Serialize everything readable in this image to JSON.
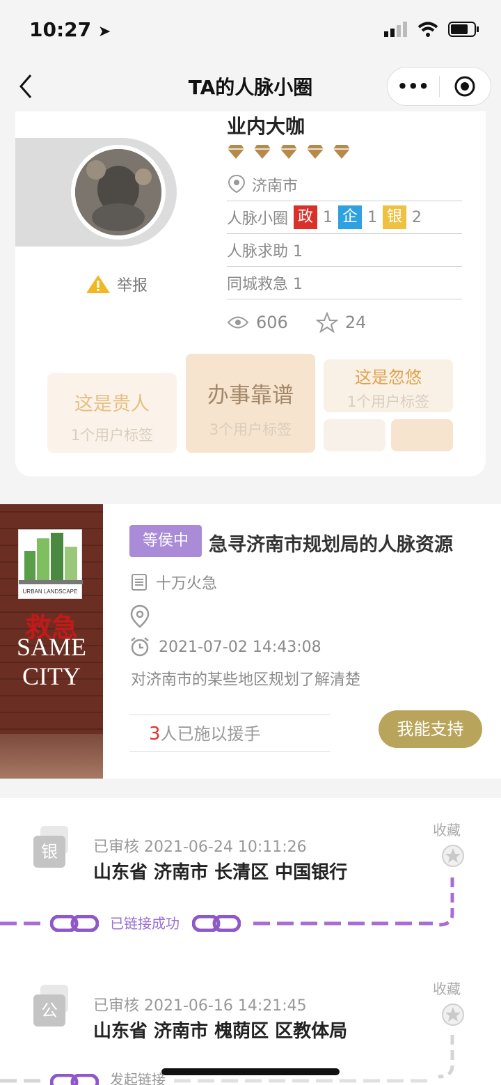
{
  "status_bar": {
    "time": "10:27"
  },
  "nav": {
    "title": "TA的人脉小圈",
    "more": "•••"
  },
  "profile": {
    "level_title": "业内大咖",
    "location": "济南市",
    "report_label": "举报",
    "circle_label": "人脉小圈",
    "circle_tags": [
      {
        "label": "政",
        "count": "1",
        "color": "#d9302a"
      },
      {
        "label": "企",
        "count": "1",
        "color": "#2fa0e0"
      },
      {
        "label": "银",
        "count": "2",
        "color": "#f0c040"
      }
    ],
    "help_row": "人脉求助 1",
    "emergency_row": "同城救急 1",
    "views": "606",
    "stars": "24",
    "tags": [
      {
        "title": "这是贵人",
        "sub": "1个用户标签"
      },
      {
        "title": "办事靠谱",
        "sub": "3个用户标签"
      },
      {
        "title": "这是忽悠",
        "sub": "1个用户标签"
      }
    ]
  },
  "help": {
    "poster_cn": "救急",
    "poster_en_1": "SAME",
    "poster_en_2": "CITY",
    "poster_logo": "URBAN LANDSCAPE",
    "status": "等侯中",
    "title": "急寻济南市规划局的人脉资源",
    "urgency": "十万火急",
    "time": "2021-07-02 14:43:08",
    "desc": "对济南市的某些地区规划了解清楚",
    "helpers_count": "3",
    "helpers_text": "人已施以援手",
    "support_button": "我能支持"
  },
  "links": [
    {
      "icon": "银",
      "meta": "已审核 2021-06-24 10:11:26",
      "addr": "山东省 济南市 长清区 中国银行",
      "fav": "收藏",
      "status": "已链接成功"
    },
    {
      "icon": "公",
      "meta": "已审核 2021-06-16 14:21:45",
      "addr": "山东省 济南市 槐荫区 区教体局",
      "fav": "收藏",
      "status": "发起链接"
    }
  ]
}
